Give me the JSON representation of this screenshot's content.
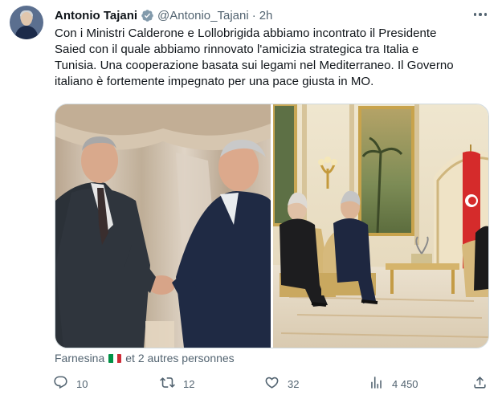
{
  "author": {
    "name": "Antonio Tajani",
    "handle": "@Antonio_Tajani",
    "separator": "·",
    "time": "2h"
  },
  "tweet": {
    "lines": [
      "Con i Ministri Calderone e Lollobrigida abbiamo incontrato il Presidente",
      "Saied con il quale abbiamo rinnovato l'amicizia strategica tra Italia e",
      "Tunisia. Una cooperazione basata sui legami nel Mediterraneo. Il Governo",
      "italiano è fortemente impegnato per una pace giusta in MO."
    ]
  },
  "social_context": {
    "account": "Farnesina",
    "rest": "et 2 autres personnes"
  },
  "actions": {
    "replies": "10",
    "retweets": "12",
    "likes": "32",
    "views": "4 450"
  },
  "icons": {
    "verified": "verified-badge-icon",
    "more": "more-icon",
    "reply": "reply-icon",
    "retweet": "retweet-icon",
    "like": "heart-icon",
    "views": "views-icon",
    "share": "share-icon"
  },
  "colors": {
    "verified": "#829aab",
    "text": "#0f1419",
    "muted": "#536471",
    "border": "#cfd9de",
    "flag_green": "#009246",
    "flag_white": "#ffffff",
    "flag_red": "#ce2b37"
  }
}
